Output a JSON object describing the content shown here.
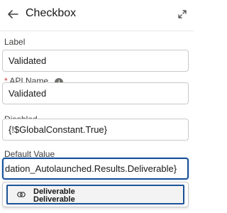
{
  "header": {
    "title": "Checkbox",
    "back_icon": "back-arrow-icon",
    "expand_icon": "expand-icon"
  },
  "fields": {
    "label": {
      "label": "Label",
      "value": "Validated"
    },
    "api_name": {
      "required_marker": "*",
      "label": "API Name",
      "info_icon": "i",
      "value": "Validated"
    },
    "disabled": {
      "label": "Disabled",
      "value": "{!$GlobalConstant.True}"
    },
    "default_value": {
      "label": "Default Value",
      "value": "dation_Autolaunched.Results.Deliverable}"
    }
  },
  "dropdown": {
    "options": [
      {
        "title": "Deliverable",
        "subtitle": "Deliverable",
        "icon": "merge-circles-icon"
      }
    ]
  },
  "colors": {
    "focus_border": "#1b5297",
    "required": "#c23934",
    "text": "#181818"
  }
}
